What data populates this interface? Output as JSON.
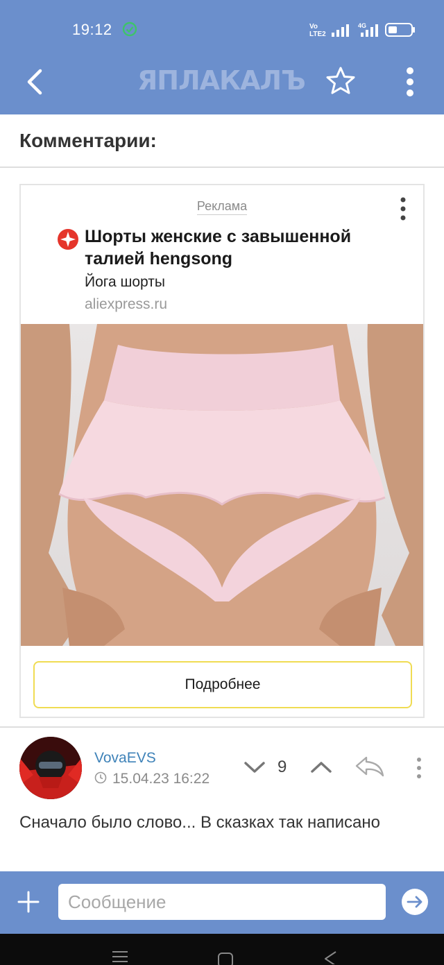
{
  "status_bar": {
    "time": "19:12",
    "volte": "Vo LTE2",
    "net_type": "4G"
  },
  "header": {
    "logo_text": "ЯПЛАКАЛЪ"
  },
  "comments": {
    "title": "Комментарии:"
  },
  "ad": {
    "label": "Реклама",
    "title": "Шорты женские с завышенной талией hengsong",
    "subtitle": "Йога шорты",
    "domain": "aliexpress.ru",
    "button_label": "Подробнее"
  },
  "comment": {
    "author": "VovaEVS",
    "date": "15.04.23 16:22",
    "score": "9",
    "text": "Сначало было слово... В сказках так написано"
  },
  "message": {
    "placeholder": "Сообщение"
  },
  "colors": {
    "header_bg": "#6b8fcc",
    "author_link": "#3e82b8",
    "ad_button_border": "#f0dc52"
  }
}
